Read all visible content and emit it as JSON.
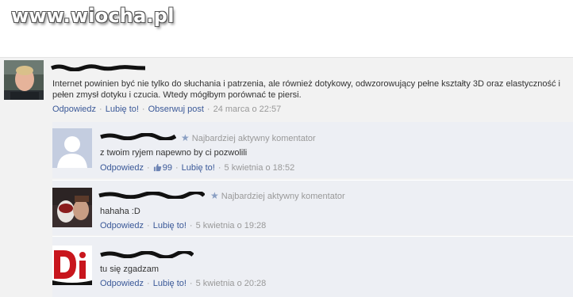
{
  "watermark": {
    "text": "www.wiocha.pl"
  },
  "post": {
    "text": "Internet powinien być nie tylko do słuchania i patrzenia, ale również dotykowy, odwzorowujący pełne kształty 3D oraz elastyczność i pełen zmysł dotyku i czucia. Wtedy mógłbym porównać te piersi.",
    "actions": {
      "reply": "Odpowiedz",
      "like": "Lubię to!",
      "follow": "Obserwuj post",
      "timestamp": "24 marca o 22:57"
    }
  },
  "replies": [
    {
      "badge": "Najbardziej aktywny komentator",
      "text": "z twoim ryjem napewno by ci pozwolili",
      "actions": {
        "reply": "Odpowiedz",
        "likes_count": "99",
        "like": "Lubię to!",
        "timestamp": "5 kwietnia o 18:52"
      }
    },
    {
      "badge": "Najbardziej aktywny komentator",
      "text": "hahaha :D",
      "actions": {
        "reply": "Odpowiedz",
        "like": "Lubię to!",
        "timestamp": "5 kwietnia o 19:28"
      }
    },
    {
      "text": "tu się zgadzam",
      "actions": {
        "reply": "Odpowiedz",
        "like": "Lubię to!",
        "timestamp": "5 kwietnia o 20:28"
      }
    }
  ],
  "separator": "·",
  "colors": {
    "link": "#3b5998",
    "meta": "#999999",
    "reply_bg": "#edeff4",
    "post_bg": "#f2f2f2"
  }
}
